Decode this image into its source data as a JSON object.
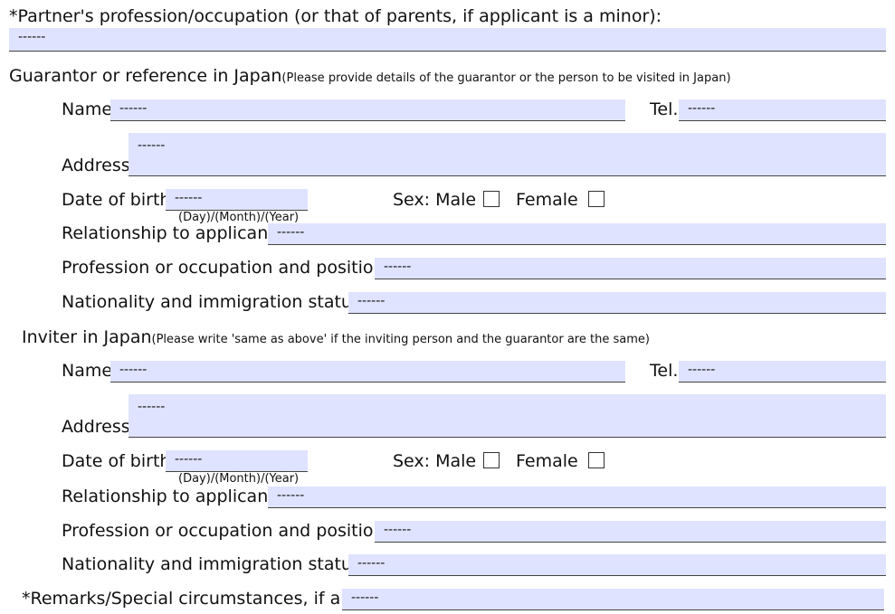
{
  "partner": {
    "label": "*Partner's profession/occupation (or that of parents, if applicant is a minor):",
    "value": "------"
  },
  "guarantor": {
    "heading": "Guarantor or reference in Japan",
    "note": "(Please provide details of the guarantor or the person to be visited in Japan)",
    "name_label": "Name",
    "name_value": "------",
    "tel_label": "Tel.",
    "tel_value": "------",
    "address_label": "Address",
    "address_value": "------",
    "dob_label": "Date of birth",
    "dob_value": "------",
    "dob_format": "(Day)/(Month)/(Year)",
    "sex_label": "Sex: Male",
    "female_label": "Female",
    "relationship_label": "Relationship to applicant",
    "relationship_value": "------",
    "profession_label": "Profession or occupation and position",
    "profession_value": "------",
    "nationality_label": "Nationality and immigration status",
    "nationality_value": "------"
  },
  "inviter": {
    "heading": "Inviter in Japan",
    "note": "(Please write 'same as above' if the inviting person and the guarantor are the same)",
    "name_label": "Name",
    "name_value": "------",
    "tel_label": "Tel.",
    "tel_value": "------",
    "address_label": "Address",
    "address_value": "------",
    "dob_label": "Date of birth",
    "dob_value": "------",
    "dob_format": "(Day)/(Month)/(Year)",
    "sex_label": "Sex: Male",
    "female_label": "Female",
    "relationship_label": "Relationship to applicant",
    "relationship_value": "------",
    "profession_label": "Profession or occupation and position",
    "profession_value": "------",
    "nationality_label": "Nationality and immigration status",
    "nationality_value": "------"
  },
  "remarks": {
    "label": "*Remarks/Special circumstances, if any",
    "value": "------"
  },
  "colors": {
    "field_fill": "#dfe3ff",
    "field_rule": "#444444"
  }
}
